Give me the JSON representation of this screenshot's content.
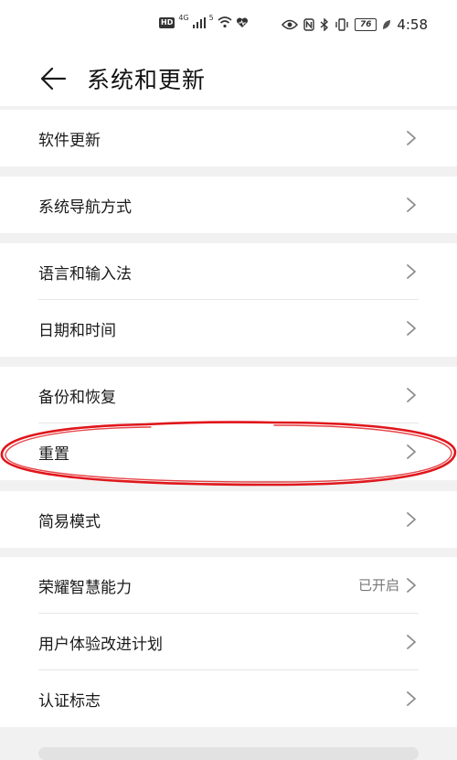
{
  "status_bar": {
    "network_badge": "HD",
    "signal_gen_1": "4G",
    "signal_gen_2": "5",
    "battery_level": "76",
    "time": "4:58",
    "icons": [
      "hd-icon",
      "signal-4g-icon",
      "signal-bars-icon",
      "wifi-icon",
      "health-heart-icon",
      "eye-comfort-icon",
      "nfc-icon",
      "bluetooth-icon",
      "vibrate-icon",
      "battery-icon",
      "leaf-icon"
    ]
  },
  "header": {
    "title": "系统和更新",
    "back_icon": "arrow-left-icon"
  },
  "groups": [
    {
      "items": [
        {
          "label": "软件更新",
          "value": ""
        }
      ]
    },
    {
      "items": [
        {
          "label": "系统导航方式",
          "value": ""
        }
      ]
    },
    {
      "items": [
        {
          "label": "语言和输入法",
          "value": ""
        },
        {
          "label": "日期和时间",
          "value": ""
        }
      ]
    },
    {
      "items": [
        {
          "label": "备份和恢复",
          "value": ""
        },
        {
          "label": "重置",
          "value": ""
        }
      ]
    },
    {
      "items": [
        {
          "label": "简易模式",
          "value": ""
        }
      ]
    },
    {
      "items": [
        {
          "label": "荣耀智慧能力",
          "value": "已开启"
        },
        {
          "label": "用户体验改进计划",
          "value": ""
        },
        {
          "label": "认证标志",
          "value": ""
        }
      ]
    }
  ],
  "annotation": {
    "color": "#e0161b",
    "circled_item": "重置"
  },
  "colors": {
    "background": "#f1f1f1",
    "card": "#ffffff",
    "chevron": "#8c8c8c",
    "value_text": "#777777"
  }
}
